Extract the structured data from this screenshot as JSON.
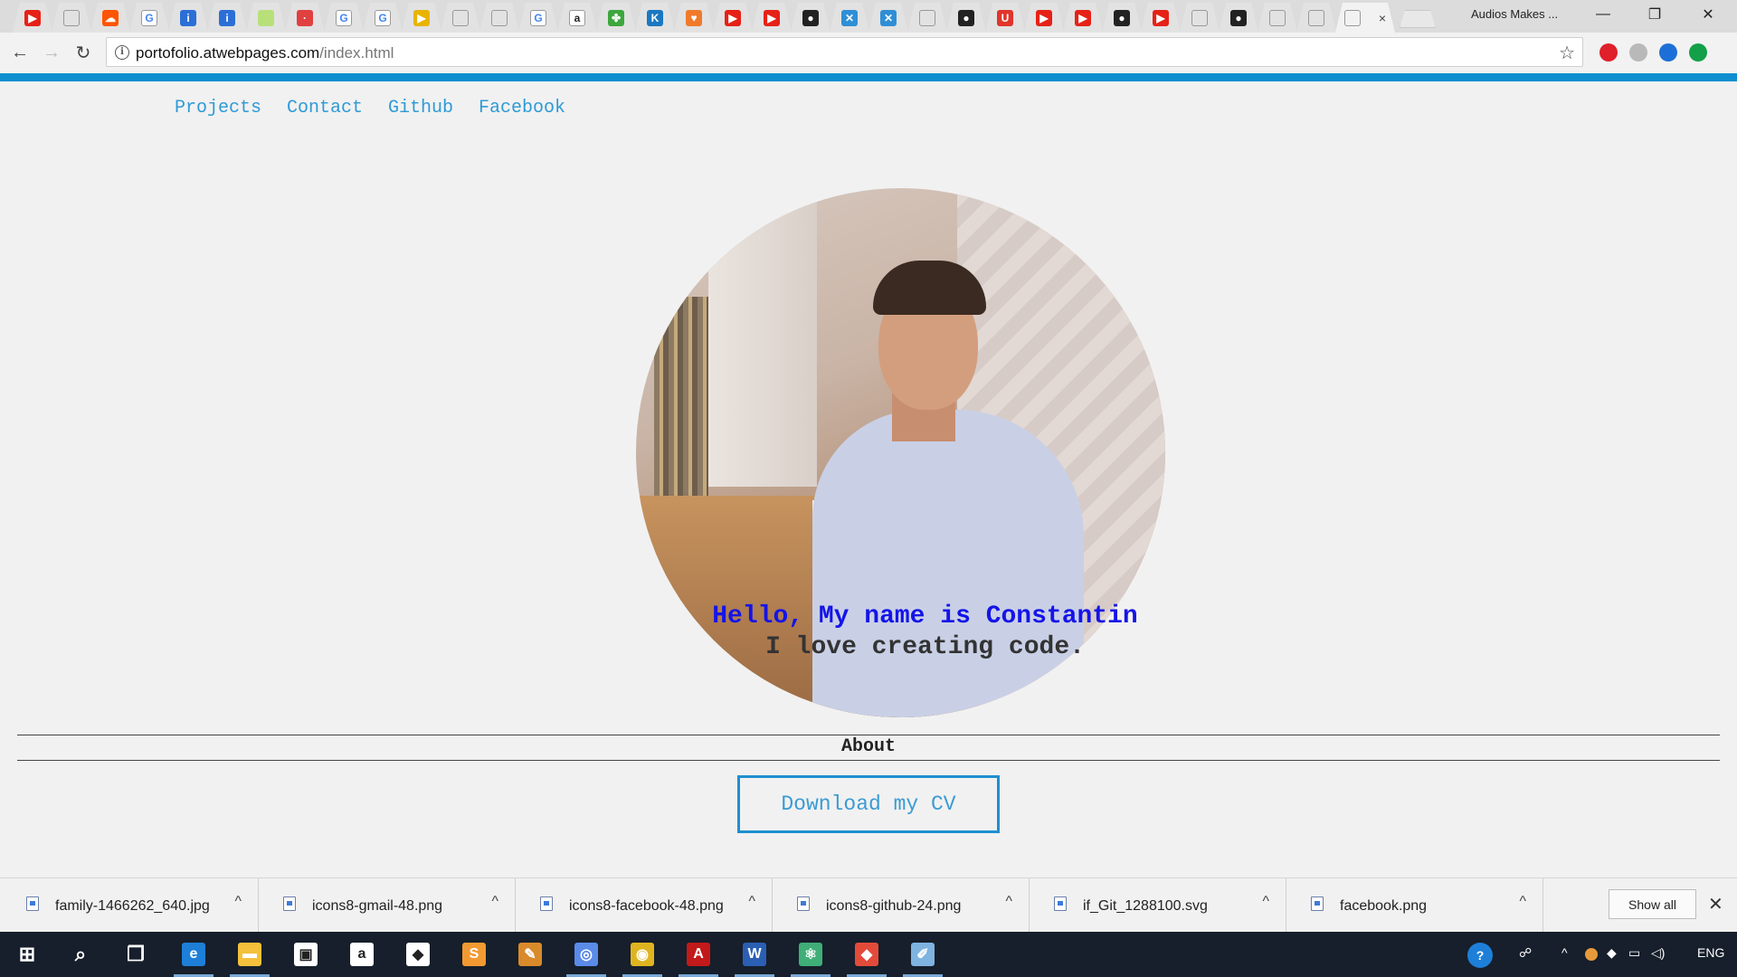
{
  "browser": {
    "tabs": [
      {
        "icon": "youtube-icon",
        "color": "#e62117",
        "glyph": "▶"
      },
      {
        "icon": "blank-page-icon",
        "color": "#c9c9c9",
        "glyph": ""
      },
      {
        "icon": "soundcloud-icon",
        "color": "#ff5500",
        "glyph": "☁"
      },
      {
        "icon": "google-icon",
        "color": "#ffffff",
        "glyph": "G"
      },
      {
        "icon": "info-i-icon",
        "color": "#2b6fd6",
        "glyph": "i"
      },
      {
        "icon": "info-i-icon",
        "color": "#2b6fd6",
        "glyph": "i"
      },
      {
        "icon": "green-circle-icon",
        "color": "#b8e07a",
        "glyph": ""
      },
      {
        "icon": "radio-icon",
        "color": "#e04040",
        "glyph": "·"
      },
      {
        "icon": "google-icon",
        "color": "#ffffff",
        "glyph": "G"
      },
      {
        "icon": "google-icon",
        "color": "#ffffff",
        "glyph": "G"
      },
      {
        "icon": "colorful-play-icon",
        "color": "#e8b400",
        "glyph": "▶"
      },
      {
        "icon": "blank-page-icon",
        "color": "#c9c9c9",
        "glyph": ""
      },
      {
        "icon": "blank-page-icon",
        "color": "#c9c9c9",
        "glyph": ""
      },
      {
        "icon": "google-icon",
        "color": "#ffffff",
        "glyph": "G"
      },
      {
        "icon": "amazon-icon",
        "color": "#ffffff",
        "glyph": "a"
      },
      {
        "icon": "clover-icon",
        "color": "#3da63d",
        "glyph": "✤"
      },
      {
        "icon": "k-icon",
        "color": "#1a78c2",
        "glyph": "K"
      },
      {
        "icon": "shield-icon",
        "color": "#f07a2a",
        "glyph": "♥"
      },
      {
        "icon": "youtube-icon",
        "color": "#e62117",
        "glyph": "▶"
      },
      {
        "icon": "youtube-icon",
        "color": "#e62117",
        "glyph": "▶"
      },
      {
        "icon": "github-icon",
        "color": "#222222",
        "glyph": "●"
      },
      {
        "icon": "x-close-icon",
        "color": "#2e8fd6",
        "glyph": "✕"
      },
      {
        "icon": "x-close-icon",
        "color": "#2e8fd6",
        "glyph": "✕"
      },
      {
        "icon": "blank-page-icon",
        "color": "#c9c9c9",
        "glyph": ""
      },
      {
        "icon": "github-icon",
        "color": "#222222",
        "glyph": "●"
      },
      {
        "icon": "u-icon",
        "color": "#e0352b",
        "glyph": "U"
      },
      {
        "icon": "youtube-icon",
        "color": "#e62117",
        "glyph": "▶"
      },
      {
        "icon": "youtube-icon",
        "color": "#e62117",
        "glyph": "▶"
      },
      {
        "icon": "github-icon",
        "color": "#222222",
        "glyph": "●"
      },
      {
        "icon": "youtube-icon",
        "color": "#e62117",
        "glyph": "▶"
      },
      {
        "icon": "blank-page-icon",
        "color": "#c9c9c9",
        "glyph": ""
      },
      {
        "icon": "github-icon",
        "color": "#222222",
        "glyph": "●"
      },
      {
        "icon": "grid-page-icon",
        "color": "#c9c9c9",
        "glyph": ""
      },
      {
        "icon": "blank-page-icon",
        "color": "#c9c9c9",
        "glyph": ""
      }
    ],
    "active_tab_close": "×",
    "profile_name": "Audios Makes ...",
    "window_controls": {
      "minimize": "—",
      "restore": "❐",
      "close": "✕"
    },
    "nav": {
      "back": "←",
      "forward": "→",
      "reload": "↻"
    },
    "omnibox": {
      "info": "i",
      "url_host": "portofolio.atwebpages.com",
      "url_path": "/index.html",
      "star": "☆"
    },
    "extensions": [
      {
        "icon": "opera-icon",
        "color": "#e0202b"
      },
      {
        "icon": "tab-manager-icon",
        "color": "#b9b9b9"
      },
      {
        "icon": "search-ext-icon",
        "color": "#1d6fd8"
      },
      {
        "icon": "upload-ext-icon",
        "color": "#13a048"
      }
    ],
    "accent_color": "#0d8ece"
  },
  "page": {
    "nav": [
      "Projects",
      "Contact",
      "Github",
      "Facebook"
    ],
    "hero_title": "Hello, My name is Constantin",
    "hero_subtitle": "I love creating code.",
    "about_label": "About",
    "cv_button": "Download my CV",
    "link_color": "#2e9ad6",
    "title_color": "#1414e8"
  },
  "downloads": {
    "items": [
      {
        "name": "family-1466262_640.jpg"
      },
      {
        "name": "icons8-gmail-48.png"
      },
      {
        "name": "icons8-facebook-48.png"
      },
      {
        "name": "icons8-github-24.png"
      },
      {
        "name": "if_Git_1288100.svg"
      },
      {
        "name": "facebook.png"
      }
    ],
    "caret": "^",
    "show_all": "Show all",
    "close": "✕"
  },
  "taskbar": {
    "apps": [
      {
        "icon": "windows-start-icon",
        "color": "#ffffff",
        "glyph": "⊞"
      },
      {
        "icon": "search-icon",
        "color": "#ffffff",
        "glyph": "⌕"
      },
      {
        "icon": "task-view-icon",
        "color": "#ffffff",
        "glyph": "❐"
      },
      {
        "icon": "edge-icon",
        "color": "#1e7fd8",
        "glyph": "e"
      },
      {
        "icon": "file-explorer-icon",
        "color": "#f3c13b",
        "glyph": "▬"
      },
      {
        "icon": "store-icon",
        "color": "#ffffff",
        "glyph": "▣"
      },
      {
        "icon": "amazon-icon",
        "color": "#ffffff",
        "glyph": "a"
      },
      {
        "icon": "dropbox-icon",
        "color": "#ffffff",
        "glyph": "◆"
      },
      {
        "icon": "sublime-icon",
        "color": "#f29a32",
        "glyph": "S"
      },
      {
        "icon": "paint-brush-icon",
        "color": "#d98a2b",
        "glyph": "✎"
      },
      {
        "icon": "chromium-icon",
        "color": "#5a8be8",
        "glyph": "◎"
      },
      {
        "icon": "chrome-icon",
        "color": "#e0b420",
        "glyph": "◉"
      },
      {
        "icon": "acrobat-icon",
        "color": "#c21a1a",
        "glyph": "A"
      },
      {
        "icon": "word-icon",
        "color": "#2b5fb3",
        "glyph": "W"
      },
      {
        "icon": "atom-icon",
        "color": "#3fae77",
        "glyph": "⚛"
      },
      {
        "icon": "git-kraken-icon",
        "color": "#e24b3a",
        "glyph": "◆"
      },
      {
        "icon": "paint-icon",
        "color": "#7fb3e0",
        "glyph": "✐"
      }
    ],
    "tray": {
      "help": "?",
      "people": "☍",
      "chevron": "^",
      "language": "ENG"
    }
  }
}
